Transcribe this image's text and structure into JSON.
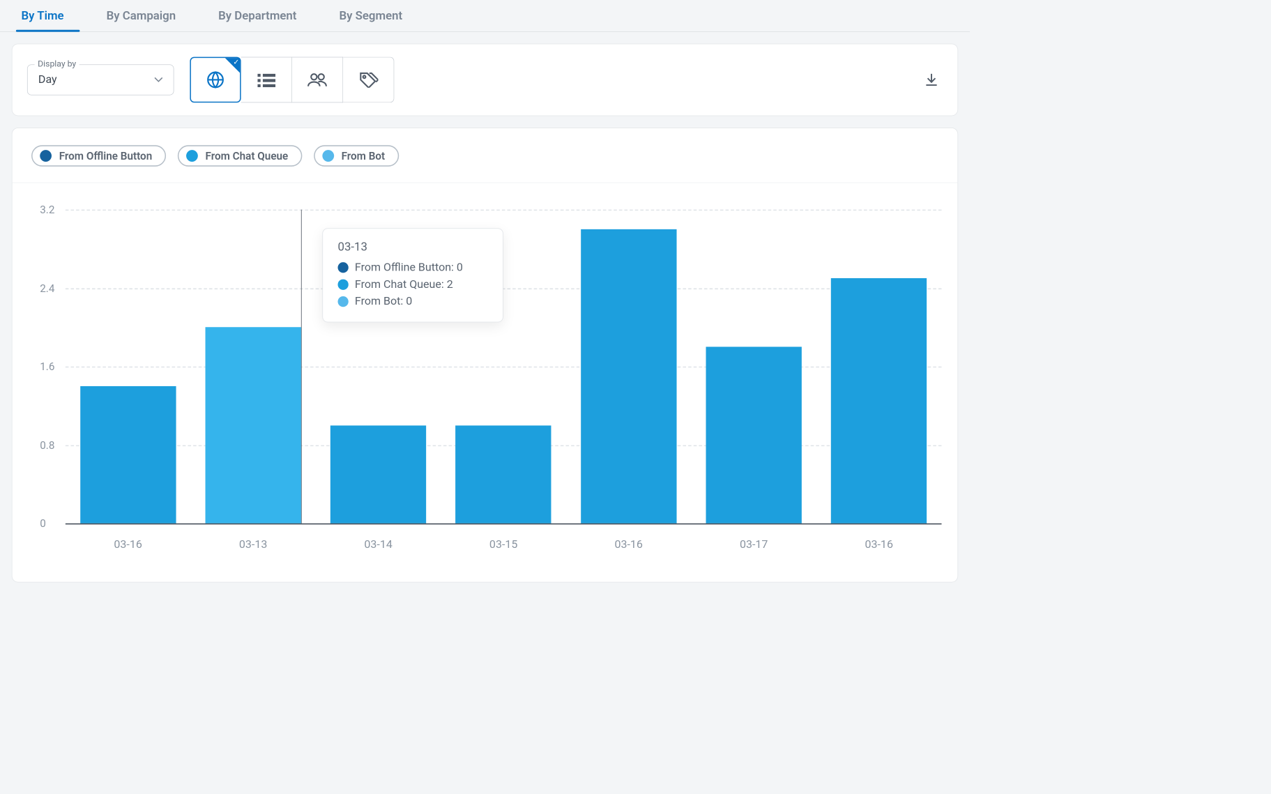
{
  "colors": {
    "series1": "#16629e",
    "series2": "#1d9fdd",
    "series3": "#56b8eb"
  },
  "tabs": [
    {
      "label": "By Time",
      "active": true
    },
    {
      "label": "By Campaign",
      "active": false
    },
    {
      "label": "By Department",
      "active": false
    },
    {
      "label": "By Segment",
      "active": false
    }
  ],
  "display_by": {
    "label": "Display by",
    "value": "Day"
  },
  "view_buttons": {
    "globe": "globe-icon-button",
    "list": "list-icon-button",
    "people": "people-icon-button",
    "tag": "tag-icon-button"
  },
  "legend": [
    {
      "key": "series1",
      "label": "From Offline Button"
    },
    {
      "key": "series2",
      "label": "From Chat Queue"
    },
    {
      "key": "series3",
      "label": "From Bot"
    }
  ],
  "chart_data": {
    "type": "bar",
    "categories": [
      "03-16",
      "03-13",
      "03-14",
      "03-15",
      "03-16",
      "03-17",
      "03-16"
    ],
    "series": [
      {
        "name": "From Offline Button",
        "values": [
          0,
          0,
          0,
          0,
          0,
          0,
          0
        ]
      },
      {
        "name": "From Chat Queue",
        "values": [
          1.4,
          2.0,
          1.0,
          1.0,
          3.0,
          1.8,
          2.5
        ]
      },
      {
        "name": "From Bot",
        "values": [
          0,
          0,
          0,
          0,
          0,
          0,
          0
        ]
      }
    ],
    "ylim": [
      0,
      3.2
    ],
    "yticks": [
      0,
      0.8,
      1.6,
      2.4,
      3.2
    ],
    "tooltip": {
      "index": 1,
      "title": "03-13",
      "rows": [
        {
          "series": "series1",
          "label": "From Offline Button",
          "value": 0
        },
        {
          "series": "series2",
          "label": "From Chat Queue",
          "value": 2
        },
        {
          "series": "series3",
          "label": "From Bot",
          "value": 0
        }
      ]
    }
  },
  "scale": 0.763
}
